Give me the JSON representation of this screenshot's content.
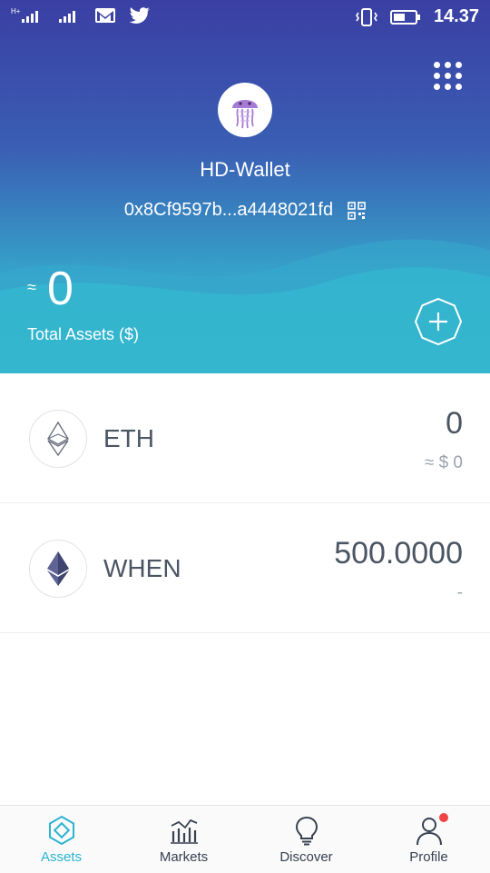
{
  "status_bar": {
    "time": "14.37",
    "left_icons": [
      "signal-h-icon",
      "signal-icon",
      "gmail-icon",
      "twitter-icon"
    ],
    "right_icons": [
      "vibrate-icon",
      "battery-icon"
    ]
  },
  "wallet": {
    "name": "HD-Wallet",
    "address": "0x8Cf9597b...a4448021fd",
    "approx_symbol": "≈",
    "total_value": "0",
    "total_label": "Total Assets ($)"
  },
  "assets": [
    {
      "symbol": "ETH",
      "amount": "0",
      "value": "≈ $ 0"
    },
    {
      "symbol": "WHEN",
      "amount": "500.0000",
      "value": "-"
    }
  ],
  "tabs": [
    {
      "label": "Assets",
      "icon": "assets-icon",
      "active": true
    },
    {
      "label": "Markets",
      "icon": "markets-icon",
      "active": false
    },
    {
      "label": "Discover",
      "icon": "discover-icon",
      "active": false
    },
    {
      "label": "Profile",
      "icon": "profile-icon",
      "active": false,
      "badge": true
    }
  ],
  "colors": {
    "header_top": "#3a3fa3",
    "header_bottom": "#33b9cf",
    "accent": "#2bb3d2",
    "badge": "#ef4444",
    "text_dark": "#4b5563"
  }
}
